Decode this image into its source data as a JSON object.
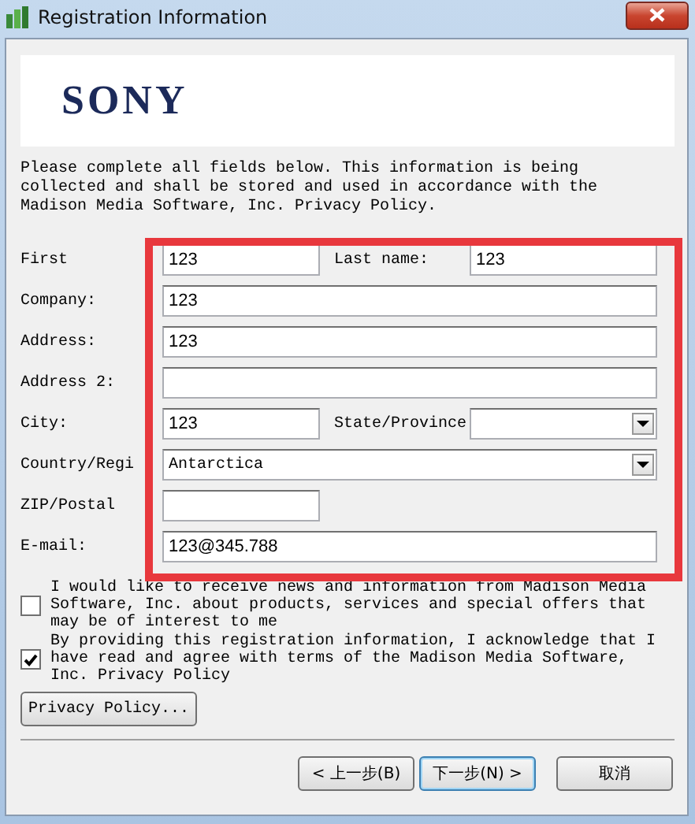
{
  "window": {
    "title": "Registration Information"
  },
  "logo": {
    "text": "SONY"
  },
  "intro": "Please complete all fields below. This information is being collected and shall be stored and used in accordance with the Madison Media Software, Inc. Privacy Policy.",
  "rows": [
    {
      "label": "First",
      "input": {
        "kind": "short",
        "value": "123"
      },
      "second": {
        "label": "Last name:",
        "input": {
          "kind": "text",
          "value": "123"
        }
      }
    },
    {
      "label": "Company:",
      "input": {
        "kind": "text",
        "value": "123"
      }
    },
    {
      "label": "Address:",
      "input": {
        "kind": "text",
        "value": "123"
      }
    },
    {
      "label": "Address 2:",
      "input": {
        "kind": "text"
      }
    },
    {
      "label": "City:",
      "input": {
        "kind": "short",
        "value": "123"
      },
      "second": {
        "label": "State/Province",
        "input": {
          "kind": "select"
        }
      }
    },
    {
      "label": "Country/Regi",
      "input": {
        "kind": "select",
        "value": "Antarctica"
      }
    },
    {
      "label": "ZIP/Postal",
      "input": {
        "kind": "short"
      }
    },
    {
      "label": "E-mail:",
      "input": {
        "kind": "text",
        "value": "123@345.788"
      }
    }
  ],
  "checkboxes": [
    {
      "text": "I would like to receive news and information from Madison Media Software, Inc. about products, services and special offers that may be of interest to me",
      "checked": false
    },
    {
      "text": "By providing this registration information, I acknowledge that I have read and agree with terms of the Madison Media Software, Inc. Privacy Policy",
      "checked": true
    }
  ],
  "privacy_button": "Privacy Policy...",
  "buttons": [
    {
      "label": "< 上一步(B)",
      "focused": false
    },
    {
      "label": "下一步(N) >",
      "focused": true
    },
    {
      "label": "取消",
      "focused": false
    }
  ]
}
